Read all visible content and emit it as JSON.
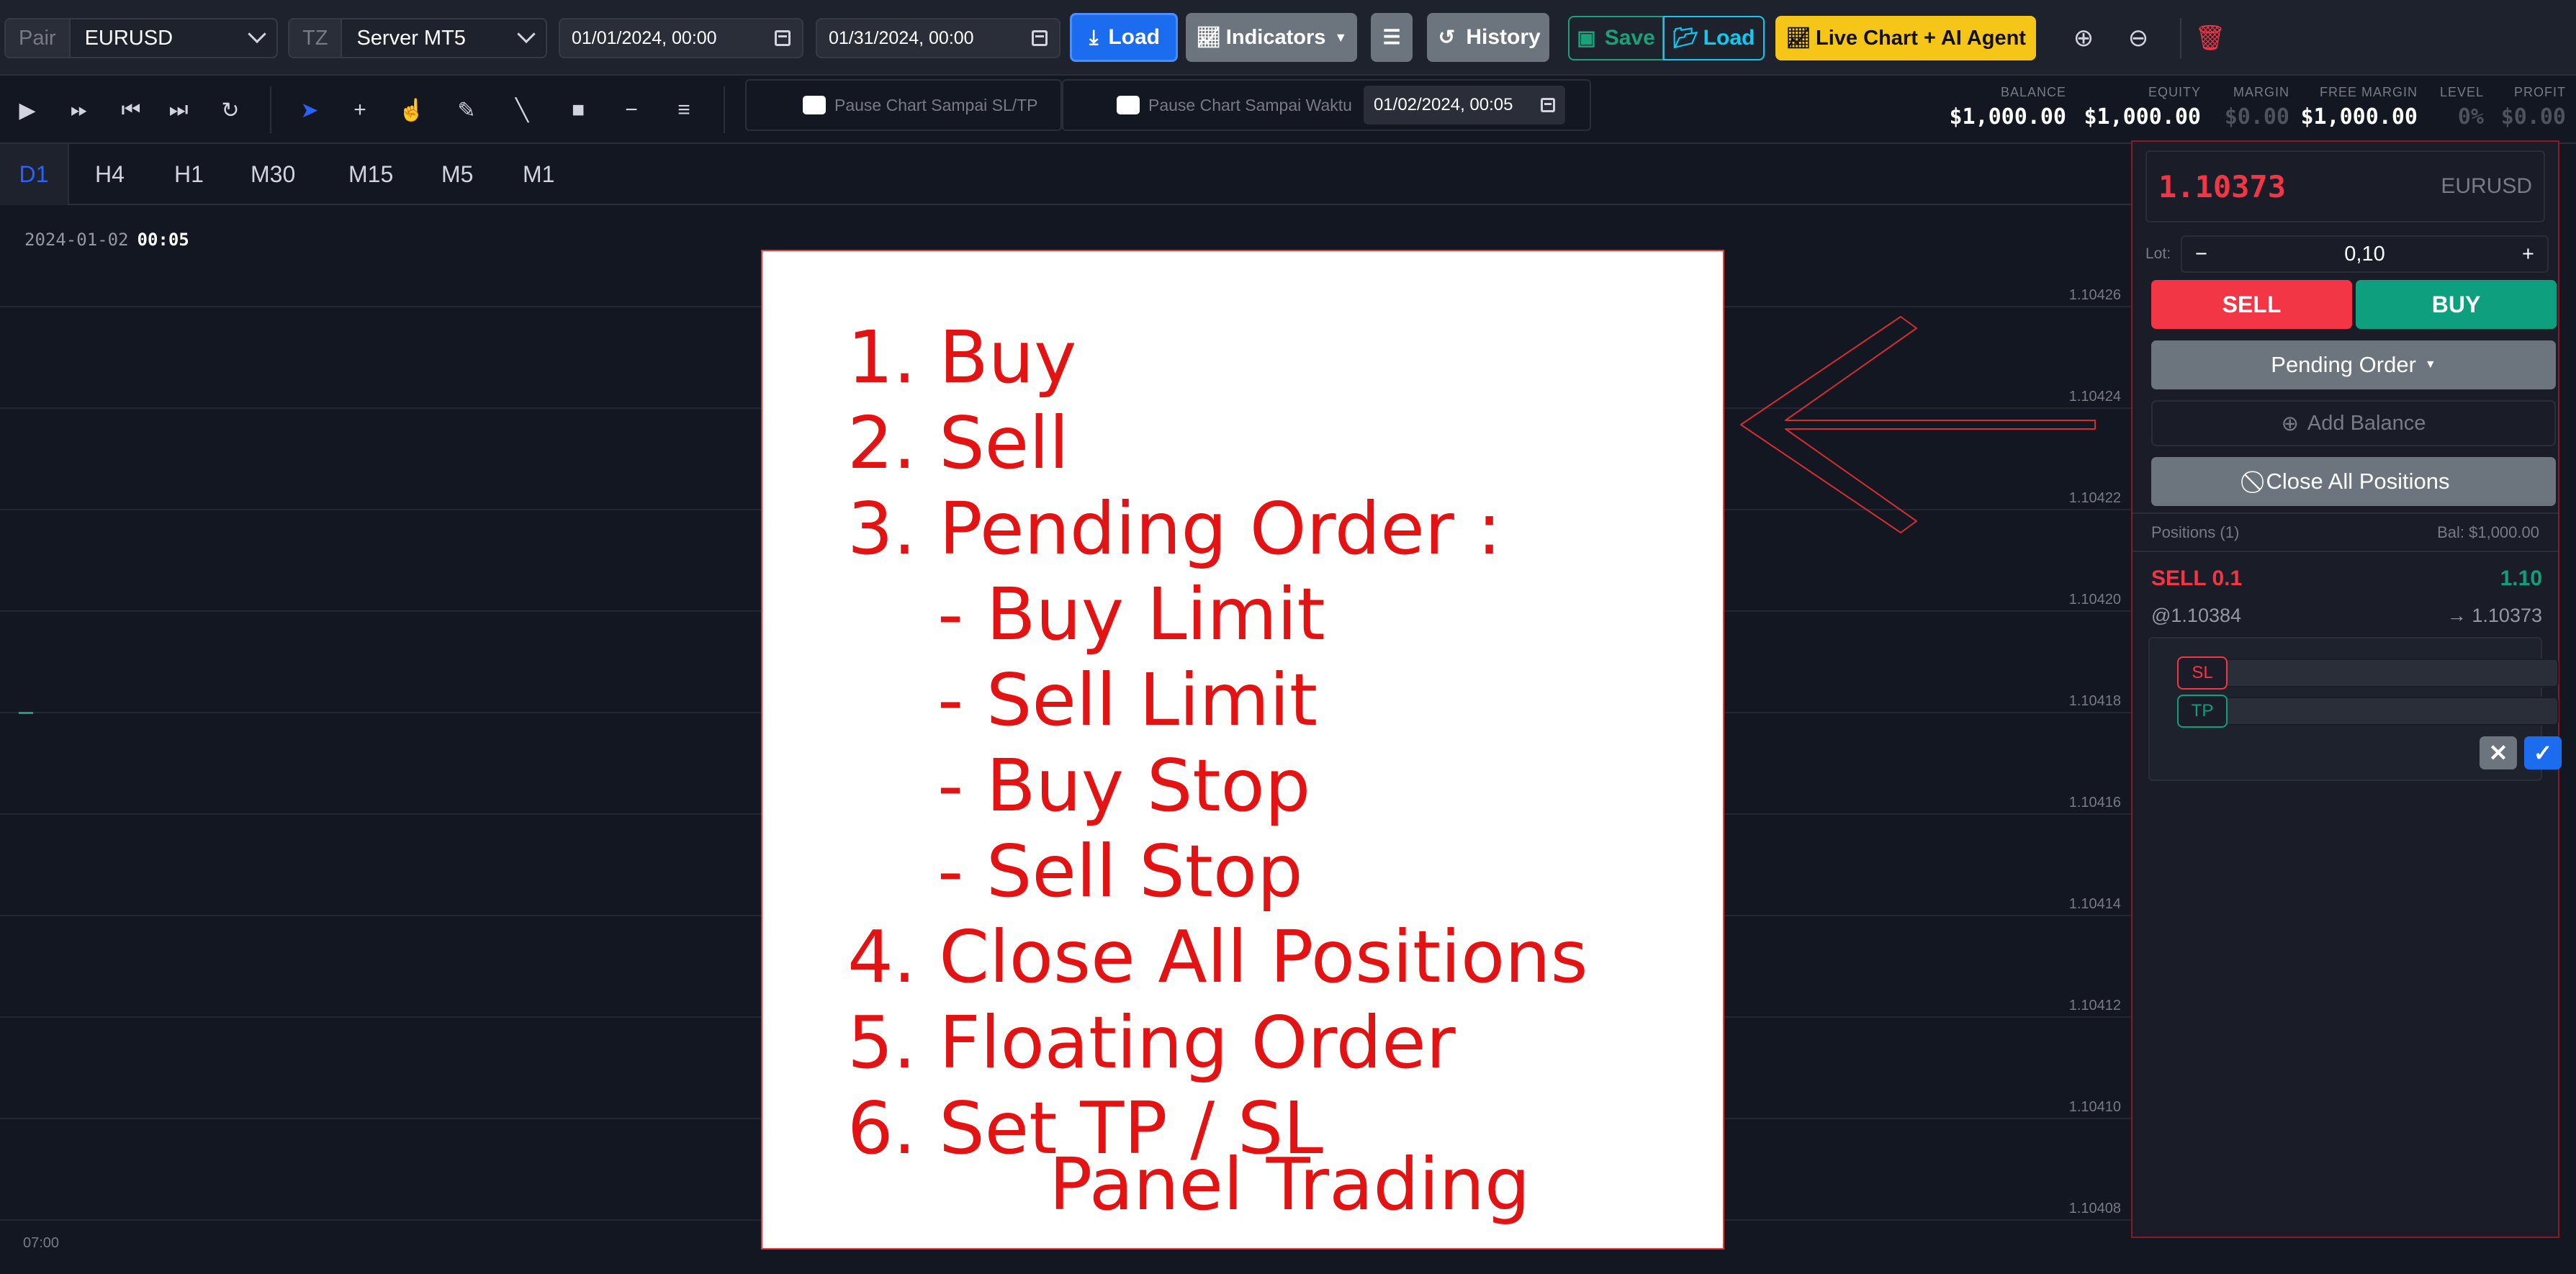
{
  "toolbar": {
    "pair_label": "Pair",
    "pair_value": "EURUSD",
    "tz_label": "TZ",
    "tz_value": "Server MT5",
    "date_start": "01/01/2024, 00:00",
    "date_end": "01/31/2024, 00:00",
    "load_label": "Load",
    "indicators_label": "Indicators",
    "history_label": "History",
    "save_label": "Save",
    "load2_label": "Load",
    "live_label": "Live Chart + AI Agent"
  },
  "controls": {
    "pause_sl_tp_label": "Pause Chart Sampai SL/TP",
    "pause_time_label": "Pause Chart Sampai Waktu",
    "pause_time_value": "01/02/2024, 00:05"
  },
  "account": {
    "balance_label": "BALANCE",
    "balance_value": "$1,000.00",
    "equity_label": "EQUITY",
    "equity_value": "$1,000.00",
    "margin_label": "MARGIN",
    "margin_value": "$0.00",
    "free_margin_label": "FREE MARGIN",
    "free_margin_value": "$1,000.00",
    "level_label": "LEVEL",
    "level_value": "0%",
    "profit_label": "PROFIT",
    "profit_value": "$0.00"
  },
  "timeframes": [
    "D1",
    "H4",
    "H1",
    "M30",
    "M15",
    "M5",
    "M1"
  ],
  "chart": {
    "date": "2024-01-02",
    "time": "00:05",
    "x_label": "07:00",
    "price_ticks": [
      "1.10426",
      "1.10424",
      "1.10422",
      "1.10420",
      "1.10418",
      "1.10416",
      "1.10414",
      "1.10412",
      "1.10410",
      "1.10408"
    ]
  },
  "overlay": {
    "items": [
      "1. Buy",
      "2. Sell",
      "3. Pending Order :",
      "- Buy Limit",
      "- Sell Limit",
      "- Buy Stop",
      "- Sell Stop",
      "4. Close All Positions",
      "5. Floating Order",
      "6. Set TP / SL"
    ],
    "caption": "Panel Trading"
  },
  "panel": {
    "price": "1.10373",
    "symbol": "EURUSD",
    "lot_label": "Lot:",
    "lot_value": "0,10",
    "sell_label": "SELL",
    "buy_label": "BUY",
    "pending_label": "Pending Order",
    "add_balance_label": "Add Balance",
    "close_all_label": "Close All Positions",
    "positions_label": "Positions (1)",
    "bal_label": "Bal: $1,000.00",
    "position": {
      "side": "SELL 0.1",
      "pnl": "1.10",
      "entry": "@1.10384",
      "current": "→ 1.10373"
    },
    "sl_label": "SL",
    "tp_label": "TP"
  },
  "colors": {
    "accent": "#2962ff",
    "sell": "#f23645",
    "buy": "#0e9f7e",
    "overlay_text": "#e41313"
  }
}
